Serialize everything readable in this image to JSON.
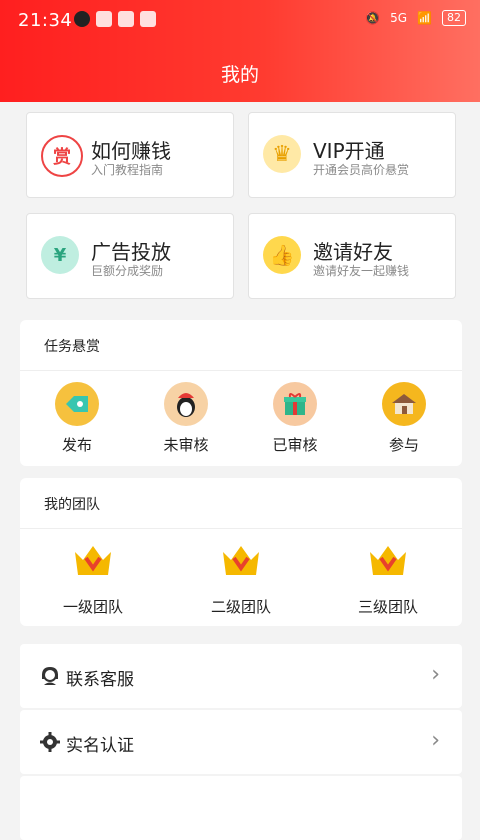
{
  "status": {
    "time": "21:34",
    "signal_text": "5G",
    "battery": "82"
  },
  "header": {
    "title": "我的"
  },
  "quick_cards": [
    {
      "title": "如何赚钱",
      "subtitle": "入门教程指南",
      "icon": "reward-icon",
      "glyph": "赏"
    },
    {
      "title": "VIP开通",
      "subtitle": "开通会员高价悬赏",
      "icon": "vip-crown-icon",
      "glyph": "♛"
    },
    {
      "title": "广告投放",
      "subtitle": "巨额分成奖励",
      "icon": "money-bag-icon",
      "glyph": "¥"
    },
    {
      "title": "邀请好友",
      "subtitle": "邀请好友一起赚钱",
      "icon": "invite-thumb-icon",
      "glyph": "👍"
    }
  ],
  "tasks": {
    "title": "任务悬赏",
    "items": [
      {
        "label": "发布",
        "icon": "publish-tag-icon"
      },
      {
        "label": "未审核",
        "icon": "penguin-icon"
      },
      {
        "label": "已审核",
        "icon": "gift-box-icon"
      },
      {
        "label": "参与",
        "icon": "house-icon"
      }
    ]
  },
  "team": {
    "title": "我的团队",
    "items": [
      {
        "label": "一级团队",
        "icon": "crown-icon"
      },
      {
        "label": "二级团队",
        "icon": "crown-icon"
      },
      {
        "label": "三级团队",
        "icon": "crown-icon"
      }
    ]
  },
  "menu": [
    {
      "label": "联系客服",
      "icon": "customer-service-icon"
    },
    {
      "label": "实名认证",
      "icon": "gear-icon"
    }
  ],
  "colors": {
    "accent": "#ff2a2a",
    "crown": "#f5b800",
    "crown_v": "#e8412c"
  }
}
